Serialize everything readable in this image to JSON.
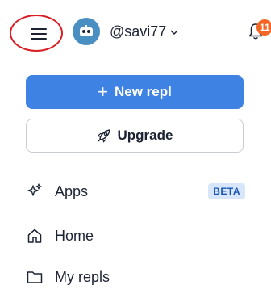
{
  "header": {
    "username": "@savi77",
    "notification_count": "11"
  },
  "actions": {
    "new_repl_label": "New repl",
    "new_repl_icon": "plus-icon",
    "upgrade_label": "Upgrade",
    "upgrade_icon": "rocket-icon"
  },
  "nav": {
    "items": [
      {
        "label": "Apps",
        "icon": "sparkle-icon",
        "badge": "BETA"
      },
      {
        "label": "Home",
        "icon": "home-icon"
      },
      {
        "label": "My repls",
        "icon": "folder-icon"
      }
    ]
  },
  "colors": {
    "primary": "#3e82e3",
    "badge": "#f26522",
    "highlight_circle": "#d81f26",
    "beta_bg": "#d7e6fb",
    "beta_text": "#1a56b5"
  }
}
